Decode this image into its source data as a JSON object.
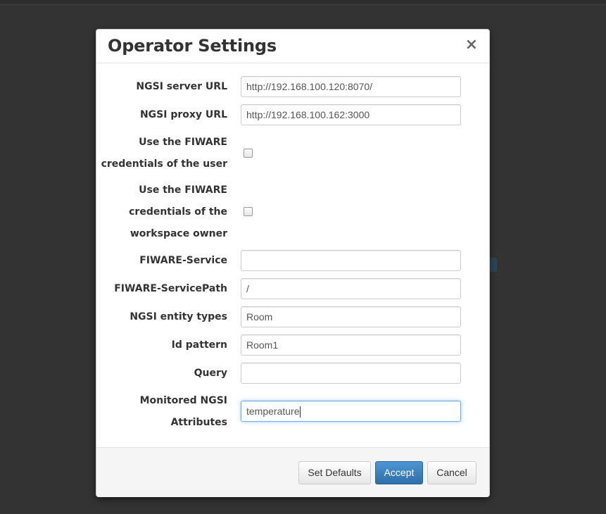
{
  "dialog": {
    "title": "Operator Settings",
    "close_label": "×",
    "fields": [
      {
        "label": "NGSI server URL",
        "value": "http://192.168.100.120:8070/",
        "placeholder": ""
      },
      {
        "label": "NGSI proxy URL",
        "value": "http://192.168.100.162:3000",
        "placeholder": ""
      },
      {
        "label_lines": [
          "Use the FIWARE",
          "credentials of the user"
        ],
        "checked": false
      },
      {
        "label_lines": [
          "Use the FIWARE",
          "credentials of the",
          "workspace owner"
        ],
        "checked": false
      },
      {
        "label": "FIWARE-Service",
        "value": "",
        "placeholder": ""
      },
      {
        "label": "FIWARE-ServicePath",
        "value": "/",
        "placeholder": ""
      },
      {
        "label": "NGSI entity types",
        "value": "Room",
        "placeholder": ""
      },
      {
        "label": "Id pattern",
        "value": "Room1",
        "placeholder": ""
      },
      {
        "label": "Query",
        "value": "",
        "placeholder": ""
      },
      {
        "label_lines": [
          "Monitored NGSI",
          "Attributes"
        ],
        "value": "temperature",
        "focused": true
      }
    ],
    "footer": {
      "set_defaults_label": "Set Defaults",
      "accept_label": "Accept",
      "cancel_label": "Cancel"
    }
  },
  "colors": {
    "backdrop": "#333333",
    "primary": "#337ab7",
    "focus_ring": "#66afe9"
  }
}
